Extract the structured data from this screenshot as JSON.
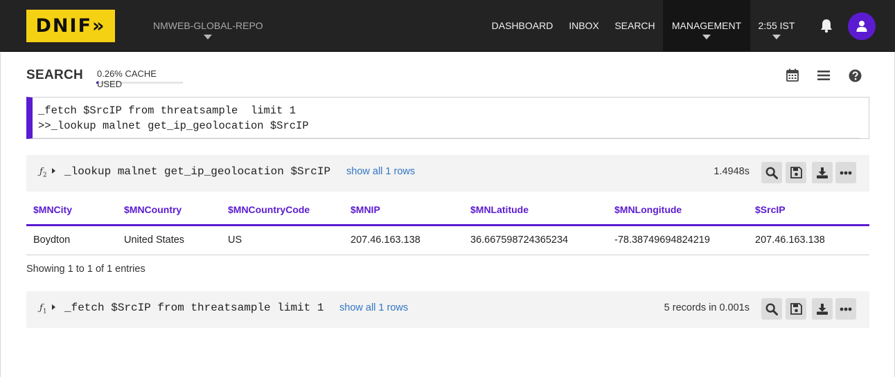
{
  "brand": {
    "logo_text": "DNIF»",
    "accent": "#5b1bd1",
    "logo_bg": "#f5d113"
  },
  "topbar": {
    "repo": "NMWEB-GLOBAL-REPO",
    "nav": [
      {
        "label": "DASHBOARD"
      },
      {
        "label": "INBOX"
      },
      {
        "label": "SEARCH"
      },
      {
        "label": "MANAGEMENT"
      },
      {
        "label": "2:55 IST"
      }
    ],
    "icons": [
      "bell-icon",
      "user-icon"
    ]
  },
  "search": {
    "title": "SEARCH",
    "cache_used": "0.26% CACHE USED",
    "toolbar_icons": [
      "calendar-icon",
      "list-icon",
      "help-icon"
    ],
    "query_lines": [
      "_fetch $SrcIP from threatsample  limit 1",
      ">>_lookup malnet get_ip_geolocation $SrcIP"
    ]
  },
  "panels": [
    {
      "fn": "ƒ",
      "fn_index": "2",
      "command": "_lookup malnet get_ip_geolocation $SrcIP",
      "show_all": "show all 1 rows",
      "timing": "1.4948s",
      "columns": [
        "$MNCity",
        "$MNCountry",
        "$MNCountryCode",
        "$MNIP",
        "$MNLatitude",
        "$MNLongitude",
        "$SrcIP"
      ],
      "rows": [
        [
          "Boydton",
          "United States",
          "US",
          "207.46.163.138",
          "36.667598724365234",
          "-78.38749694824219",
          "207.46.163.138"
        ]
      ],
      "entries": "Showing 1 to 1 of 1 entries"
    },
    {
      "fn": "ƒ",
      "fn_index": "1",
      "command": "_fetch $SrcIP from threatsample limit 1",
      "show_all": "show all 1 rows",
      "timing": "5 records in 0.001s"
    }
  ]
}
